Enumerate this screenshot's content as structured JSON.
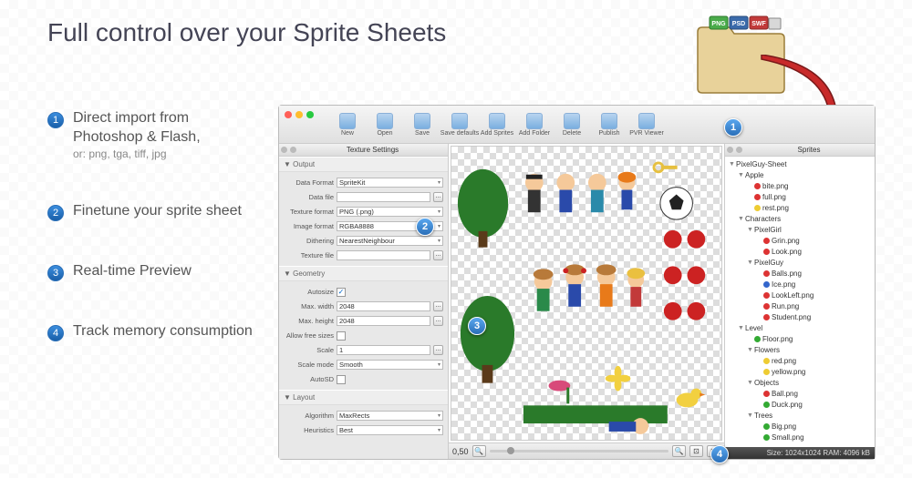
{
  "heading": "Full control over your Sprite Sheets",
  "features": [
    {
      "num": "1",
      "main": "Direct import from Photoshop & Flash,",
      "sub": "or: png, tga, tiff, jpg"
    },
    {
      "num": "2",
      "main": "Finetune your sprite sheet",
      "sub": ""
    },
    {
      "num": "3",
      "main": "Real-time Preview",
      "sub": ""
    },
    {
      "num": "4",
      "main": "Track memory consumption",
      "sub": ""
    }
  ],
  "folder_formats": [
    "PNG",
    "PSD",
    "SWF"
  ],
  "toolbar": [
    {
      "label": "New"
    },
    {
      "label": "Open"
    },
    {
      "label": "Save"
    },
    {
      "label": "Save defaults"
    },
    {
      "label": "Add Sprites"
    },
    {
      "label": "Add Folder"
    },
    {
      "label": "Delete"
    },
    {
      "label": "Publish"
    },
    {
      "label": "PVR Viewer"
    }
  ],
  "panels": {
    "settings_title": "Texture Settings",
    "sprites_title": "Sprites"
  },
  "output": {
    "section": "Output",
    "data_format": {
      "label": "Data Format",
      "value": "SpriteKit"
    },
    "data_file": {
      "label": "Data file",
      "value": ""
    },
    "texture_format": {
      "label": "Texture format",
      "value": "PNG (.png)"
    },
    "image_format": {
      "label": "Image format",
      "value": "RGBA8888"
    },
    "dithering": {
      "label": "Dithering",
      "value": "NearestNeighbour"
    },
    "texture_file": {
      "label": "Texture file",
      "value": ""
    }
  },
  "geometry": {
    "section": "Geometry",
    "autosize": {
      "label": "Autosize",
      "checked": true
    },
    "max_width": {
      "label": "Max. width",
      "value": "2048"
    },
    "max_height": {
      "label": "Max. height",
      "value": "2048"
    },
    "allow_free_sizes": {
      "label": "Allow free sizes",
      "checked": false
    },
    "scale": {
      "label": "Scale",
      "value": "1"
    },
    "scale_mode": {
      "label": "Scale mode",
      "value": "Smooth"
    },
    "auto_sd": {
      "label": "AutoSD",
      "checked": false
    }
  },
  "layout_section": {
    "section": "Layout",
    "algorithm": {
      "label": "Algorithm",
      "value": "MaxRects"
    },
    "heuristics": {
      "label": "Heuristics",
      "value": "Best"
    }
  },
  "preview": {
    "zoom": "0,50"
  },
  "tree": {
    "root": "PixelGuy-Sheet",
    "items": [
      {
        "indent": 0,
        "type": "folder",
        "label": "PixelGuy-Sheet"
      },
      {
        "indent": 1,
        "type": "folder",
        "label": "Apple"
      },
      {
        "indent": 2,
        "type": "leaf",
        "color": "red",
        "label": "bite.png"
      },
      {
        "indent": 2,
        "type": "leaf",
        "color": "red",
        "label": "full.png"
      },
      {
        "indent": 2,
        "type": "leaf",
        "color": "yellow",
        "label": "rest.png"
      },
      {
        "indent": 1,
        "type": "folder",
        "label": "Characters"
      },
      {
        "indent": 2,
        "type": "folder",
        "label": "PixelGirl"
      },
      {
        "indent": 3,
        "type": "leaf",
        "color": "red",
        "label": "Grin.png"
      },
      {
        "indent": 3,
        "type": "leaf",
        "color": "red",
        "label": "Look.png"
      },
      {
        "indent": 2,
        "type": "folder",
        "label": "PixelGuy"
      },
      {
        "indent": 3,
        "type": "leaf",
        "color": "red",
        "label": "Balls.png"
      },
      {
        "indent": 3,
        "type": "leaf",
        "color": "blue",
        "label": "Ice.png"
      },
      {
        "indent": 3,
        "type": "leaf",
        "color": "red",
        "label": "LookLeft.png"
      },
      {
        "indent": 3,
        "type": "leaf",
        "color": "red",
        "label": "Run.png"
      },
      {
        "indent": 3,
        "type": "leaf",
        "color": "red",
        "label": "Student.png"
      },
      {
        "indent": 1,
        "type": "folder",
        "label": "Level"
      },
      {
        "indent": 2,
        "type": "leaf",
        "color": "green",
        "label": "Floor.png"
      },
      {
        "indent": 2,
        "type": "folder",
        "label": "Flowers"
      },
      {
        "indent": 3,
        "type": "leaf",
        "color": "yellow",
        "label": "red.png"
      },
      {
        "indent": 3,
        "type": "leaf",
        "color": "yellow",
        "label": "yellow.png"
      },
      {
        "indent": 2,
        "type": "folder",
        "label": "Objects"
      },
      {
        "indent": 3,
        "type": "leaf",
        "color": "red",
        "label": "Ball.png"
      },
      {
        "indent": 3,
        "type": "leaf",
        "color": "green",
        "label": "Duck.png"
      },
      {
        "indent": 2,
        "type": "folder",
        "label": "Trees"
      },
      {
        "indent": 3,
        "type": "leaf",
        "color": "green",
        "label": "Big.png"
      },
      {
        "indent": 3,
        "type": "leaf",
        "color": "green",
        "label": "Small.png"
      }
    ]
  },
  "status": {
    "text": "Size: 1024x1024 RAM: 4096 kB"
  }
}
